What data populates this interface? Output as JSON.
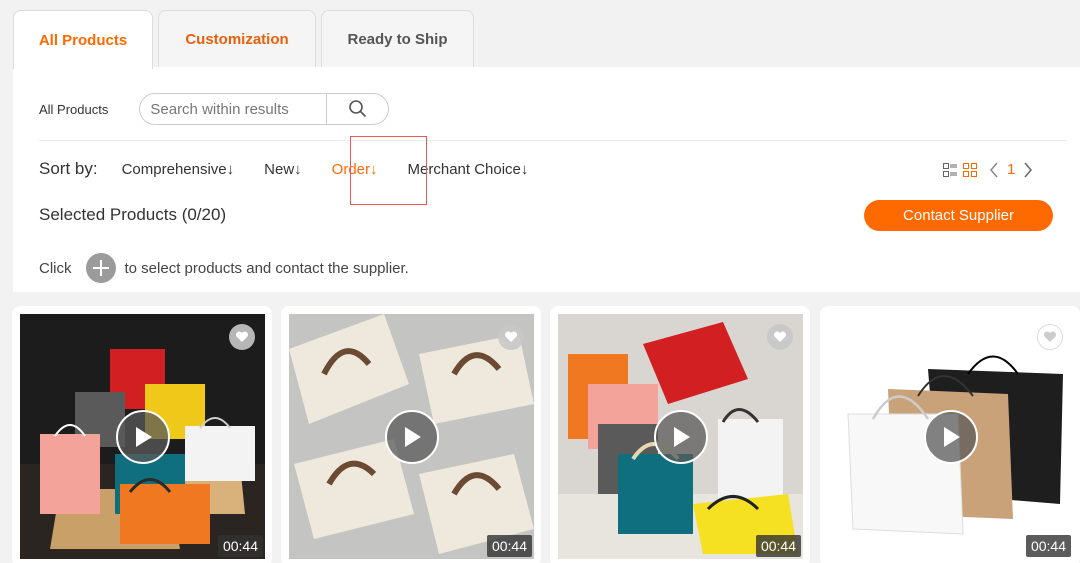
{
  "tabs": [
    {
      "label": "All Products"
    },
    {
      "label": "Customization"
    },
    {
      "label": "Ready to Ship"
    }
  ],
  "filter": {
    "breadcrumb": "All Products",
    "search_placeholder": "Search within results"
  },
  "sort": {
    "label": "Sort by:",
    "options": [
      {
        "label": "Comprehensive↓"
      },
      {
        "label": "New↓"
      },
      {
        "label": "Order↓"
      },
      {
        "label": "Merchant Choice↓"
      }
    ],
    "active": "Order↓"
  },
  "pager": {
    "current": "1"
  },
  "selection": {
    "text": "Selected Products (0/20)",
    "contact_label": "Contact Supplier",
    "click_prefix": "Click",
    "click_suffix": "to select products and contact the supplier."
  },
  "products": [
    {
      "duration": "00:44"
    },
    {
      "duration": "00:44"
    },
    {
      "duration": "00:44"
    },
    {
      "duration": "00:44"
    }
  ],
  "colors": {
    "accent": "#ff6a00"
  }
}
